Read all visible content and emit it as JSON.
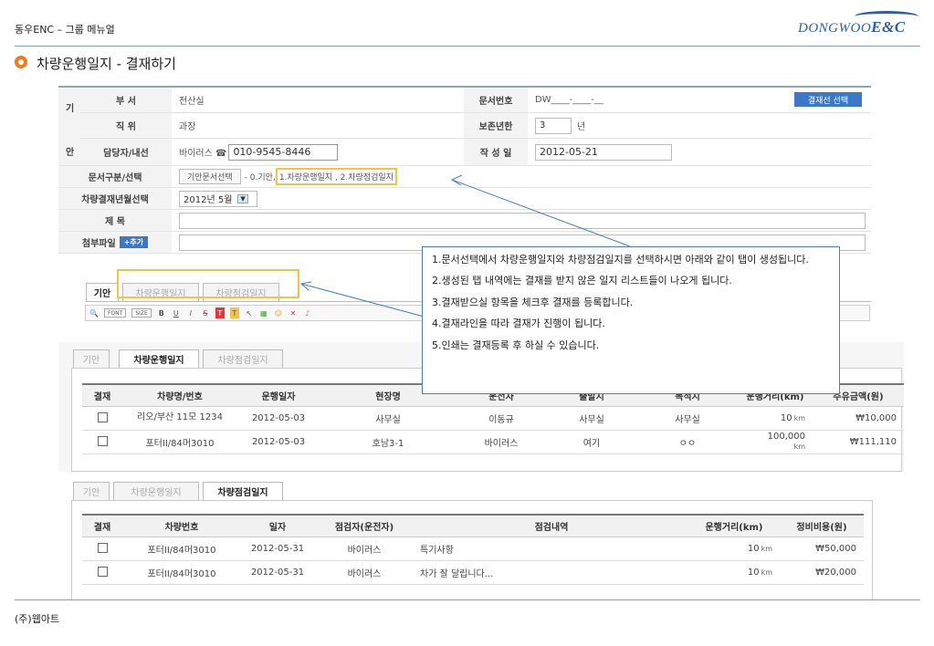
{
  "header": {
    "title": "동우ENC – 그룹 메뉴얼",
    "logo_main": "DONGWOO",
    "logo_sub": "E&C"
  },
  "section_title": "차량운행일지 - 결재하기",
  "form": {
    "side_labels": [
      "기",
      "안"
    ],
    "dept_label": "부 서",
    "dept_value": "전산실",
    "docno_label": "문서번호",
    "docno_value": "DW____-____-__",
    "approval_line_button": "결재선 선택",
    "position_label": "직 위",
    "position_value": "과장",
    "retention_label": "보존년한",
    "retention_value": "3",
    "retention_unit": "년",
    "manager_label": "담당자/내선",
    "manager_name": "바이러스 ☎",
    "manager_phone": "010-9545-8446",
    "date_label": "작 성 일",
    "date_value": "2012-05-21",
    "doctype_label": "문서구분/선택",
    "doctype_button": "기안문서선택",
    "doctype_prefix": "- 0.기안,",
    "doctype_selected": "1.차량운행일지 , 2.차량점검일지",
    "ym_label": "차량결재년월선택",
    "ym_value": "2012년 5월",
    "subject_label": "제 목",
    "attach_label": "첨부파일",
    "attach_button": "+추가"
  },
  "editor_tabs": [
    "기안",
    "차량운행일지",
    "차량점검일지"
  ],
  "toolbar": {
    "font": "FONT",
    "size": "SIZE"
  },
  "callout": [
    "1.문서선택에서 차량운행일지와 차량점검일지를 선택하시면 아래와 같이 탭이 생성됩니다.",
    "2.생성된 탭 내역에는 결재를 받지 않은 일지 리스트들이 나오게 됩니다.",
    "3.결재받으실 항목을 체크후 결재를 등록합니다.",
    "4.결재라인을 따라 결재가 진행이 됩니다.",
    "5.인쇄는 결재등록 후 하실 수 있습니다."
  ],
  "panel1": {
    "tabs": [
      "기안",
      "차량운행일지",
      "차량점검일지"
    ],
    "headers": [
      "결재",
      "차량명/번호",
      "운행일자",
      "현장명",
      "운전자",
      "출발지",
      "목적지",
      "운행거리(km)",
      "주유금액(원)"
    ],
    "rows": [
      {
        "vehicle": "리오/부산 11모 1234",
        "date": "2012-05-03",
        "site": "사무실",
        "driver": "이동규",
        "from": "사무실",
        "to": "사무실",
        "distance": "10",
        "unit": "km",
        "amount": "₩10,000"
      },
      {
        "vehicle": "포터II/84머3010",
        "date": "2012-05-03",
        "site": "호남3-1",
        "driver": "바이러스",
        "from": "여기",
        "to": "ㅇㅇ",
        "distance": "100,000",
        "unit": "km",
        "amount": "₩111,110"
      }
    ]
  },
  "panel2": {
    "tabs": [
      "기안",
      "차량운행일지",
      "차량점검일지"
    ],
    "headers": [
      "결재",
      "차량번호",
      "일자",
      "점검자(운전자)",
      "점검내역",
      "운행거리(km)",
      "정비비용(원)"
    ],
    "rows": [
      {
        "vehicle": "포터II/84머3010",
        "date": "2012-05-31",
        "inspector": "바이러스",
        "detail": "특기사항",
        "distance": "10",
        "unit": "km",
        "cost": "₩50,000"
      },
      {
        "vehicle": "포터II/84머3010",
        "date": "2012-05-31",
        "inspector": "바이러스",
        "detail": "차가 잘 달립니다...",
        "distance": "10",
        "unit": "km",
        "cost": "₩20,000"
      }
    ]
  },
  "footer": "(주)웹아트",
  "colors": {
    "accent": "#3b78c9",
    "bullet": "#f07d1a",
    "highlight": "#f6c242",
    "callout_border": "#4a7ebb"
  }
}
